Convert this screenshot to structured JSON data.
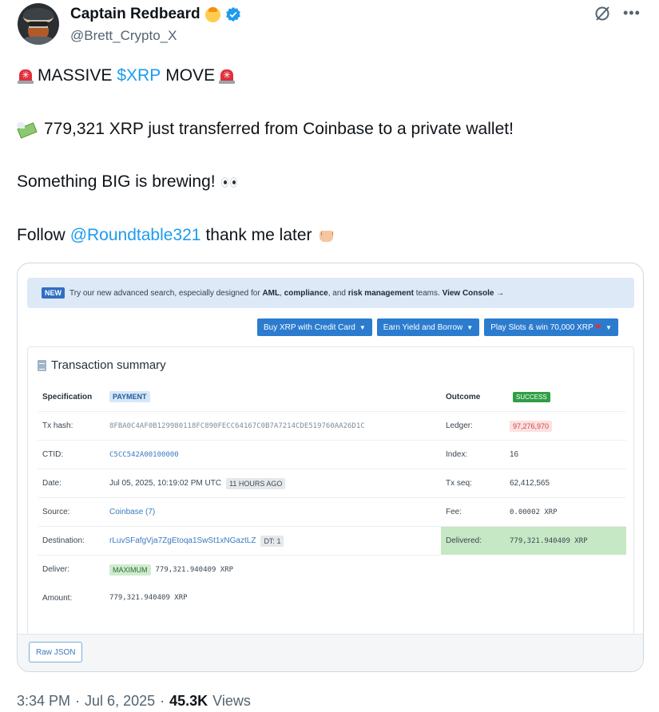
{
  "author": {
    "display_name": "Captain Redbeard",
    "handle": "@Brett_Crypto_X"
  },
  "tweet": {
    "line1": {
      "pre": "MASSIVE",
      "ticker": "$XRP",
      "post": "MOVE"
    },
    "line2": "779,321 XRP just transferred from Coinbase to a private wallet!",
    "line3": "Something BIG is brewing!",
    "line4": {
      "pre": "Follow",
      "mention": "@Roundtable321",
      "post": "thank me later"
    }
  },
  "embed": {
    "notice": {
      "badge": "NEW",
      "text_a": "Try our new advanced search, especially designed for",
      "bold_a": "AML",
      "sep1": ",",
      "bold_b": "compliance",
      "text_b": ", and",
      "bold_c": "risk management",
      "text_c": "teams.",
      "bold_d": "View Console →"
    },
    "actions": [
      "Buy XRP with Credit Card",
      "Earn Yield and Borrow",
      "Play Slots & win 70,000 XRP"
    ],
    "panel_title": "Transaction summary",
    "left_rows": {
      "specification": {
        "label": "Specification",
        "value": "PAYMENT"
      },
      "tx_hash": {
        "label": "Tx hash:",
        "value": "8FBA0C4AF0B129980118FC890FECC64167C0B7A7214CDE519760AA26D1C"
      },
      "ctid": {
        "label": "CTID:",
        "value": "C5CC542A00100000"
      },
      "date": {
        "label": "Date:",
        "value": "Jul 05, 2025, 10:19:02 PM UTC",
        "ago": "11 HOURS AGO"
      },
      "source": {
        "label": "Source:",
        "value": "Coinbase (7)"
      },
      "destination": {
        "label": "Destination:",
        "value": "rLuvSFafgVja7ZgEtoqa1SwSt1xNGaztLZ",
        "dt": "DT: 1"
      },
      "deliver": {
        "label": "Deliver:",
        "tag": "MAXIMUM",
        "value": "779,321.940409 XRP"
      },
      "amount": {
        "label": "Amount:",
        "value": "779,321.940409 XRP"
      }
    },
    "right_rows": {
      "outcome": {
        "label": "Outcome",
        "value": "SUCCESS"
      },
      "ledger": {
        "label": "Ledger:",
        "value": "97,276,970"
      },
      "index": {
        "label": "Index:",
        "value": "16"
      },
      "tx_seq": {
        "label": "Tx seq:",
        "value": "62,412,565"
      },
      "fee": {
        "label": "Fee:",
        "value": "0.00002 XRP"
      },
      "delivered": {
        "label": "Delivered:",
        "value": "779,321.940409 XRP"
      }
    },
    "raw_json_button": "Raw JSON"
  },
  "footer": {
    "time": "3:34 PM",
    "date": "Jul 6, 2025",
    "views_count": "45.3K",
    "views_label": "Views"
  },
  "colors": {
    "link_blue": "#1d9bf0",
    "verified_blue": "#1d9bf0",
    "success_green": "#2f9e44",
    "delivered_bg": "#c6e8c5",
    "action_button_blue": "#2b7ccf"
  }
}
